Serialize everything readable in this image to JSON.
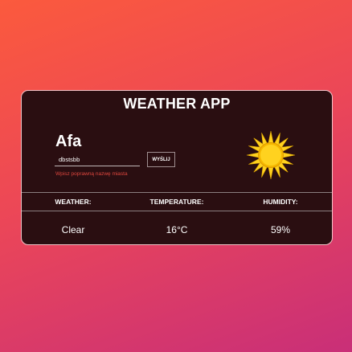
{
  "app": {
    "title": "WEATHER APP"
  },
  "location": {
    "city": "Afa"
  },
  "form": {
    "input_value": "dbstsbb",
    "button_label": "WYŚLIJ",
    "error_message": "Wpisz poprawną nazwę miasta"
  },
  "icon": {
    "name": "sun-icon",
    "color": "#ffd21f"
  },
  "table": {
    "headers": [
      "WEATHER:",
      "TEMPERATURE:",
      "HUMIDITY:"
    ],
    "values": [
      "Clear",
      "16°C",
      "59%"
    ]
  },
  "colors": {
    "card_background": "#2a0e11",
    "error": "#e0473e"
  }
}
